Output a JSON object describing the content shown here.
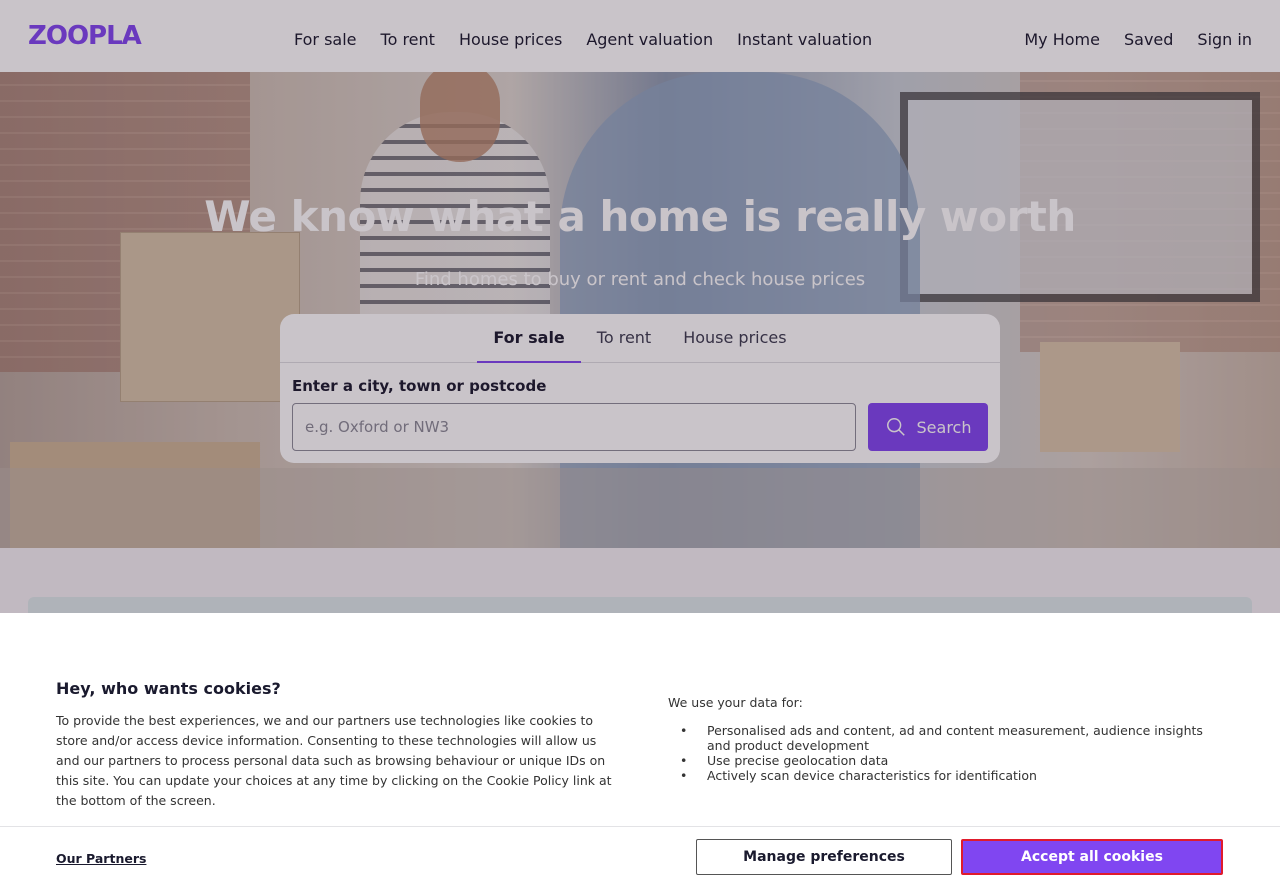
{
  "header": {
    "logo": "ZOOPLA",
    "nav": [
      "For sale",
      "To rent",
      "House prices",
      "Agent valuation",
      "Instant valuation"
    ],
    "right_nav": [
      "My Home",
      "Saved",
      "Sign in"
    ]
  },
  "hero": {
    "title": "We know what a home is really worth",
    "subtitle": "Find homes to buy or rent and check house prices"
  },
  "search": {
    "tabs": [
      "For sale",
      "To rent",
      "House prices"
    ],
    "active_tab": "For sale",
    "label": "Enter a city, town or postcode",
    "placeholder": "e.g. Oxford or NW3",
    "button": "Search"
  },
  "cookie": {
    "title": "Hey, who wants cookies?",
    "text": "To provide the best experiences, we and our partners use technologies like cookies to store and/or access device information. Consenting to these technologies will allow us and our partners to process personal data such as browsing behaviour or unique IDs on this site. You can update your choices at any time by clicking on the Cookie Policy link at the bottom of the screen.",
    "use_label": "We use your data for:",
    "uses": [
      "Personalised ads and content, ad and content measurement, audience insights and product development",
      "Use precise geolocation data",
      "Actively scan device characteristics for identification"
    ],
    "partners_link": "Our Partners",
    "manage_button": "Manage preferences",
    "accept_button": "Accept all cookies"
  },
  "colors": {
    "brand": "#8046f1",
    "accept_border": "#e01b2c"
  }
}
